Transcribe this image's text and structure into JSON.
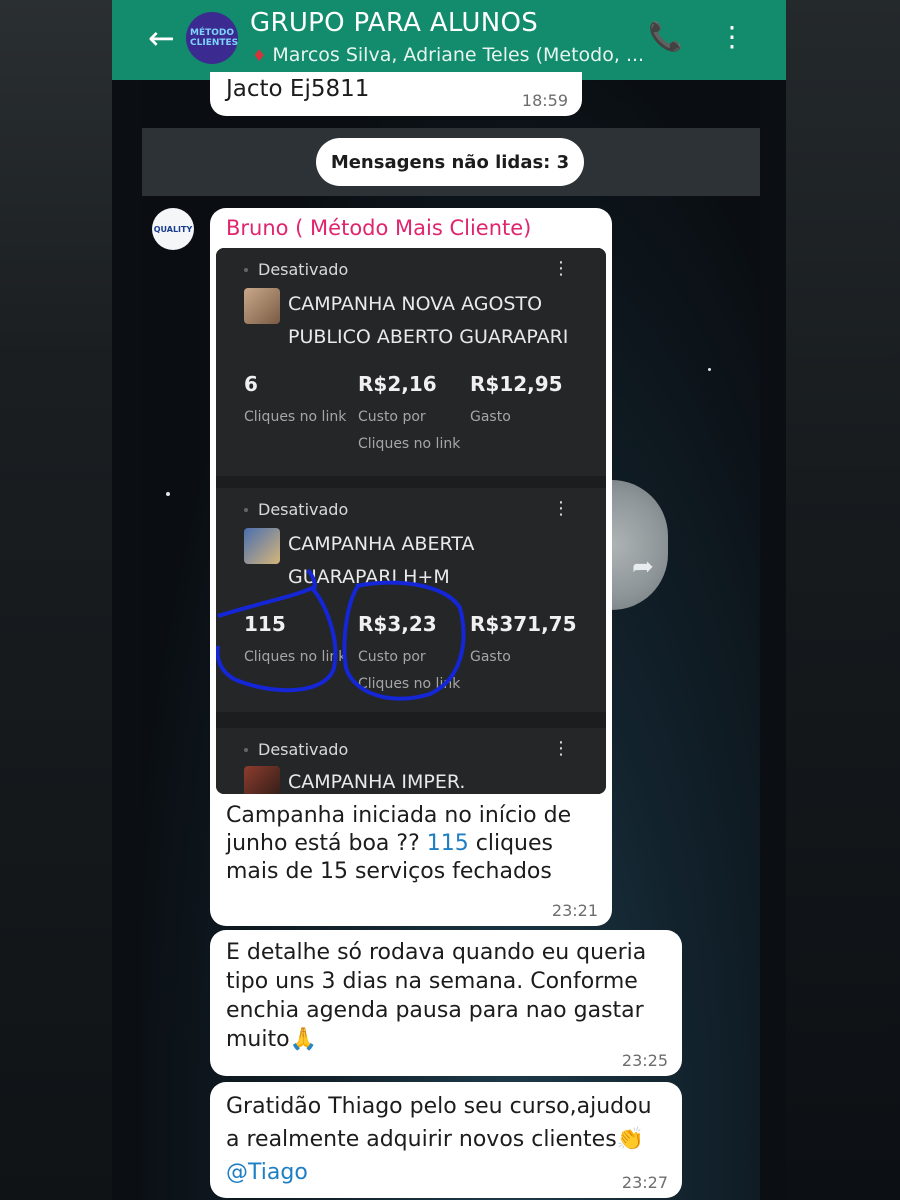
{
  "header": {
    "title": "GRUPO PARA ALUNOS",
    "subtitle": "Marcos Silva, Adriane Teles (Metodo, ...",
    "avatar_text": "MÉTODO CLIENTES"
  },
  "messages": {
    "prev": {
      "text": "Jacto Ej5811",
      "time": "18:59"
    },
    "unread": "Mensagens não lidas: 3",
    "bruno": {
      "sender": "Bruno ( Método Mais Cliente)",
      "avatar_text": "QUALITY",
      "text_before": "Campanha iniciada no início de junho está boa ?? ",
      "highlight": "115",
      "text_after": " cliques mais de 15 serviços fechados",
      "time": "23:21"
    },
    "detalhe": {
      "text": "E detalhe só rodava quando eu queria tipo uns 3 dias na semana. Conforme enchia agenda pausa para nao gastar muito🙏",
      "time": "23:25"
    },
    "gratidao": {
      "text": "Gratidão Thiago pelo seu curso,ajudou a realmente adquirir novos clientes👏",
      "mention": "@Tiago",
      "time": "23:27"
    }
  },
  "campaigns": [
    {
      "status": "Desativado",
      "name_line1": "CAMPANHA NOVA AGOSTO",
      "name_line2": "PUBLICO ABERTO GUARAPARI",
      "m1_val": "6",
      "m1_lbl1": "Cliques no link",
      "m2_val": "R$2,16",
      "m2_lbl1": "Custo por",
      "m2_lbl2": "Cliques no link",
      "m3_val": "R$12,95",
      "m3_lbl1": "Gasto"
    },
    {
      "status": "Desativado",
      "name_line1": "CAMPANHA ABERTA",
      "name_line2": "GUARAPARI H+M",
      "m1_val": "115",
      "m1_lbl1": "Cliques no link",
      "m2_val": "R$3,23",
      "m2_lbl1": "Custo por",
      "m2_lbl2": "Cliques no link",
      "m3_val": "R$371,75",
      "m3_lbl1": "Gasto"
    },
    {
      "status": "Desativado",
      "name_line1": "CAMPANHA IMPER."
    }
  ],
  "icons": {
    "back": "←",
    "call": "📞",
    "more": "⋮",
    "kebab": "⋮",
    "forward": "➦"
  },
  "colors": {
    "header": "#128c6c",
    "sender": "#e0256f",
    "link": "#1e7fc4",
    "annotation": "#1426d6"
  }
}
